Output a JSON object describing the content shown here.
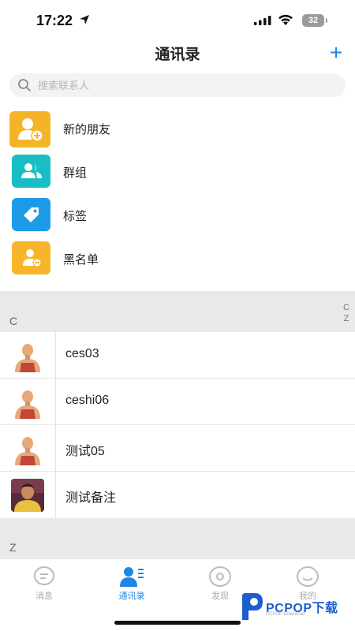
{
  "status_bar": {
    "time": "17:22",
    "battery": "32"
  },
  "header": {
    "title": "通讯录",
    "add_symbol": "+"
  },
  "search": {
    "placeholder": "搜索联系人"
  },
  "functions": [
    {
      "label": "新的朋友",
      "icon": "add-person-icon",
      "color": "#f5b428"
    },
    {
      "label": "群组",
      "icon": "group-icon",
      "color": "#19bdc5"
    },
    {
      "label": "标签",
      "icon": "tag-icon",
      "color": "#1e9be8"
    },
    {
      "label": "黑名单",
      "icon": "blocked-person-icon",
      "color": "#f7b52c"
    }
  ],
  "sections": [
    {
      "letter": "C",
      "contacts": [
        {
          "name": "ces03"
        },
        {
          "name": "ceshi06"
        },
        {
          "name": "测试05"
        },
        {
          "name": "测试备注"
        }
      ]
    },
    {
      "letter": "Z",
      "contacts": []
    }
  ],
  "index_bar": [
    "C",
    "Z"
  ],
  "tabs": [
    {
      "label": "消息",
      "icon": "message-icon",
      "active": false
    },
    {
      "label": "通讯录",
      "icon": "contacts-icon",
      "active": true
    },
    {
      "label": "发现",
      "icon": "discover-icon",
      "active": false
    },
    {
      "label": "我的",
      "icon": "profile-icon",
      "active": false
    }
  ],
  "watermark": {
    "brand": "PCPOP下载",
    "sub": "PCPOP Download"
  },
  "colors": {
    "accent": "#1e88e5",
    "section_bg": "#e9e9e9"
  }
}
